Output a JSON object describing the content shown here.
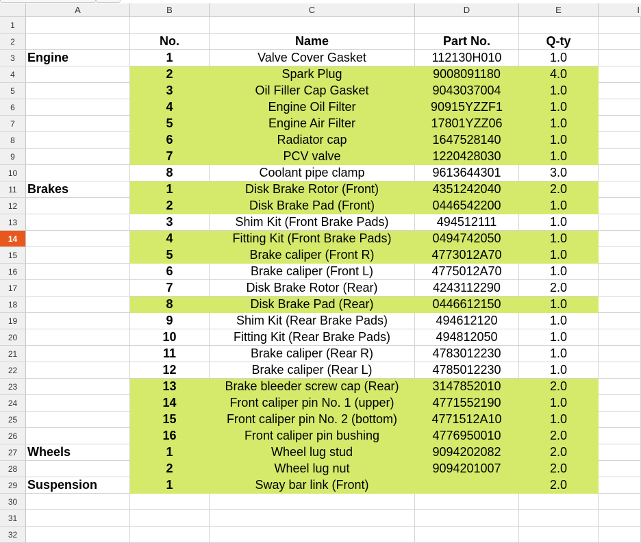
{
  "columns": [
    "A",
    "B",
    "C",
    "D",
    "E",
    "I"
  ],
  "active_row": 14,
  "highlight_color": "#d5e96a",
  "rows": [
    {
      "num": "1",
      "a": "",
      "b": "",
      "c": "",
      "d": "",
      "e": "",
      "hl": false,
      "bold_b": false
    },
    {
      "num": "2",
      "a": "",
      "b": "No.",
      "c": "Name",
      "d": "Part No.",
      "e": "Q-ty",
      "hl": false,
      "header": true
    },
    {
      "num": "3",
      "a": "Engine",
      "b": "1",
      "c": "Valve Cover Gasket",
      "d": "112130H010",
      "e": "1.0",
      "hl": false
    },
    {
      "num": "4",
      "a": "",
      "b": "2",
      "c": "Spark Plug",
      "d": "9008091180",
      "e": "4.0",
      "hl": true
    },
    {
      "num": "5",
      "a": "",
      "b": "3",
      "c": "Oil Filler Cap Gasket",
      "d": "9043037004",
      "e": "1.0",
      "hl": true
    },
    {
      "num": "6",
      "a": "",
      "b": "4",
      "c": "Engine Oil Filter",
      "d": "90915YZZF1",
      "e": "1.0",
      "hl": true
    },
    {
      "num": "7",
      "a": "",
      "b": "5",
      "c": "Engine Air Filter",
      "d": "17801YZZ06",
      "e": "1.0",
      "hl": true
    },
    {
      "num": "8",
      "a": "",
      "b": "6",
      "c": "Radiator cap",
      "d": "1647528140",
      "e": "1.0",
      "hl": true
    },
    {
      "num": "9",
      "a": "",
      "b": "7",
      "c": "PCV valve",
      "d": "1220428030",
      "e": "1.0",
      "hl": true
    },
    {
      "num": "10",
      "a": "",
      "b": "8",
      "c": "Coolant pipe clamp",
      "d": "9613644301",
      "e": "3.0",
      "hl": false
    },
    {
      "num": "11",
      "a": "Brakes",
      "b": "1",
      "c": "Disk Brake Rotor (Front)",
      "d": "4351242040",
      "e": "2.0",
      "hl": true
    },
    {
      "num": "12",
      "a": "",
      "b": "2",
      "c": "Disk Brake Pad (Front)",
      "d": "0446542200",
      "e": "1.0",
      "hl": true
    },
    {
      "num": "13",
      "a": "",
      "b": "3",
      "c": "Shim Kit (Front Brake Pads)",
      "d": "494512111",
      "e": "1.0",
      "hl": false
    },
    {
      "num": "14",
      "a": "",
      "b": "4",
      "c": "Fitting Kit (Front Brake Pads)",
      "d": "0494742050",
      "e": "1.0",
      "hl": true
    },
    {
      "num": "15",
      "a": "",
      "b": "5",
      "c": "Brake caliper (Front R)",
      "d": "4773012A70",
      "e": "1.0",
      "hl": true
    },
    {
      "num": "16",
      "a": "",
      "b": "6",
      "c": "Brake caliper (Front L)",
      "d": "4775012A70",
      "e": "1.0",
      "hl": false
    },
    {
      "num": "17",
      "a": "",
      "b": "7",
      "c": "Disk Brake Rotor (Rear)",
      "d": "4243112290",
      "e": "2.0",
      "hl": false
    },
    {
      "num": "18",
      "a": "",
      "b": "8",
      "c": "Disk Brake Pad (Rear)",
      "d": "0446612150",
      "e": "1.0",
      "hl": true
    },
    {
      "num": "19",
      "a": "",
      "b": "9",
      "c": "Shim Kit (Rear Brake Pads)",
      "d": "494612120",
      "e": "1.0",
      "hl": false
    },
    {
      "num": "20",
      "a": "",
      "b": "10",
      "c": "Fitting Kit (Rear Brake Pads)",
      "d": "494812050",
      "e": "1.0",
      "hl": false
    },
    {
      "num": "21",
      "a": "",
      "b": "11",
      "c": "Brake caliper (Rear R)",
      "d": "4783012230",
      "e": "1.0",
      "hl": false
    },
    {
      "num": "22",
      "a": "",
      "b": "12",
      "c": "Brake caliper (Rear L)",
      "d": "4785012230",
      "e": "1.0",
      "hl": false
    },
    {
      "num": "23",
      "a": "",
      "b": "13",
      "c": "Brake bleeder screw cap (Rear)",
      "d": "3147852010",
      "e": "2.0",
      "hl": true
    },
    {
      "num": "24",
      "a": "",
      "b": "14",
      "c": "Front caliper pin No. 1 (upper)",
      "d": "4771552190",
      "e": "1.0",
      "hl": true
    },
    {
      "num": "25",
      "a": "",
      "b": "15",
      "c": "Front caliper pin No. 2 (bottom)",
      "d": "4771512A10",
      "e": "1.0",
      "hl": true
    },
    {
      "num": "26",
      "a": "",
      "b": "16",
      "c": "Front caliper pin bushing",
      "d": "4776950010",
      "e": "2.0",
      "hl": true
    },
    {
      "num": "27",
      "a": "Wheels",
      "b": "1",
      "c": "Wheel lug stud",
      "d": "9094202082",
      "e": "2.0",
      "hl": true
    },
    {
      "num": "28",
      "a": "",
      "b": "2",
      "c": "Wheel lug nut",
      "d": "9094201007",
      "e": "2.0",
      "hl": true
    },
    {
      "num": "29",
      "a": "Suspension",
      "b": "1",
      "c": "Sway bar link (Front)",
      "d": "",
      "e": "2.0",
      "hl": true
    },
    {
      "num": "30",
      "a": "",
      "b": "",
      "c": "",
      "d": "",
      "e": "",
      "hl": false
    },
    {
      "num": "31",
      "a": "",
      "b": "",
      "c": "",
      "d": "",
      "e": "",
      "hl": false
    },
    {
      "num": "32",
      "a": "",
      "b": "",
      "c": "",
      "d": "",
      "e": "",
      "hl": false
    }
  ]
}
